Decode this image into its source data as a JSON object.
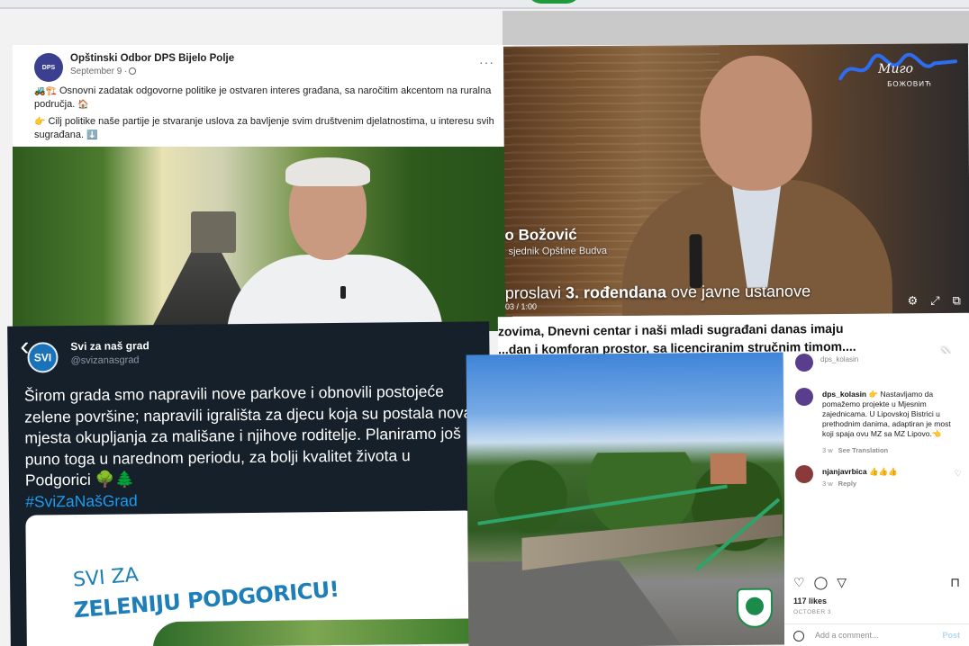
{
  "facebook": {
    "avatar_text": "DPS",
    "page_name": "Opštinski Odbor DPS Bijelo Polje",
    "date": "September 9 ·",
    "more": "···",
    "line1_emoji": "🚜🏗️",
    "line1": "Osnovni zadatak odgovorne politike je ostvaren interes građana, sa naročitim akcentom na ruralna područja.",
    "line1_end_emoji": "🏠",
    "line2_emoji": "👉",
    "line2": "Cilj politike naše partije je stvaranje uslova za bavljenje svim društvenim djelatnostima, u interesu svih sugrađana.",
    "line2_end_emoji": "⬇️"
  },
  "video": {
    "signature": "Миго",
    "signature_sub": "БОЖОВИЋ",
    "name": "o Božović",
    "role": "sjednik Opštine Budva",
    "subtitle_pre": "proslavi ",
    "subtitle_bold": "3. rođendana",
    "subtitle_post": " ove javne ustanove",
    "time": "03 / 1:00",
    "ctrl_settings": "⚙",
    "ctrl_expand": "⤢",
    "ctrl_pip": "⧉",
    "caption_line1": "zovima, Dnevni centar i naši mladi sugrađani danas imaju",
    "caption_line2": "...dan i komforan prostor, sa licenciranim stručnim timom....",
    "next_arrow": "›"
  },
  "twitter": {
    "back": "‹",
    "avatar_text": "SVI",
    "name": "Svi za naš grad",
    "handle": "@svizanasgrad",
    "body": "Širom grada smo napravili nove parkove i obnovili postojeće zelene površine; napravili igrališta za djecu koja su postala nova mjesta okupljanja za mališane i njihove roditelje. Planiramo još puno toga u narednom periodu, za bolji kvalitet života u Podgorici 🌳🌲",
    "hashtag": "#SviZaNašGrad",
    "card_line1": "SVI ZA",
    "card_line2": "ZELENIJU PODGORICU!"
  },
  "instagram": {
    "top_handle": "dps_kolasin",
    "comment1_user": "dps_kolasin",
    "comment1_text": "👉 Nastavljamo da pomažemo projekte u Mjesnim zajednicama. U Lipovskoj Bistrici u prethodnim danima, adaptiran je most koji spaja ovu MZ sa MZ Lipovo.👈",
    "comment1_time": "3 w",
    "comment1_action": "See Translation",
    "comment2_user": "njanjavrbica",
    "comment2_text": "👍👍👍",
    "comment2_time": "3 w",
    "comment2_action": "Reply",
    "like_icon": "♡",
    "comment_icon": "◯",
    "share_icon": "▽",
    "save_icon": "⊓",
    "likes": "117 likes",
    "date": "OCTOBER 3",
    "add_comment": "Add a comment...",
    "post_label": "Post"
  }
}
